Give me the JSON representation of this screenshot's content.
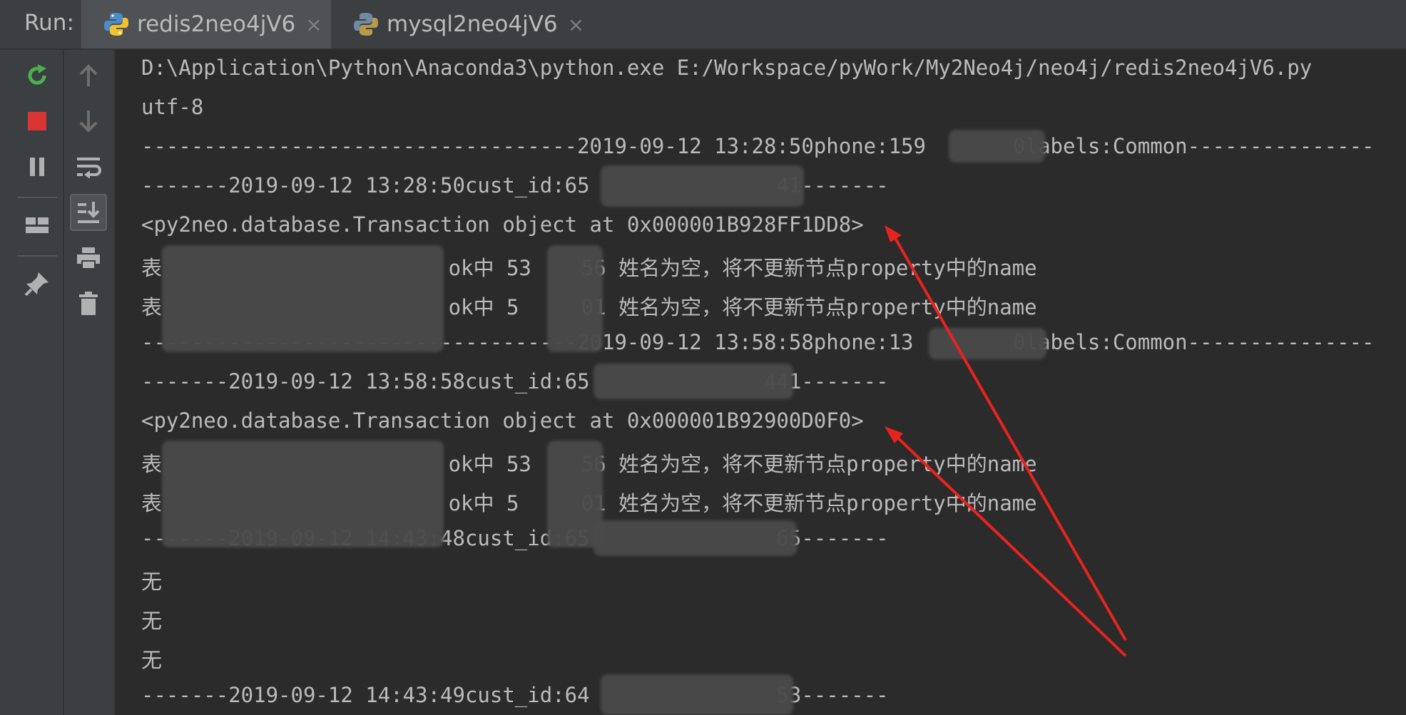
{
  "header": {
    "run_label": "Run:",
    "tabs": [
      {
        "label": "redis2neo4jV6",
        "close": "×"
      },
      {
        "label": "mysql2neo4jV6",
        "close": "×"
      }
    ]
  },
  "console": {
    "lines": [
      "D:\\Application\\Python\\Anaconda3\\python.exe E:/Workspace/pyWork/My2Neo4j/neo4j/redis2neo4jV6.py",
      "utf-8",
      "-----------------------------------2019-09-12 13:28:50phone:159       0labels:Common---------------",
      "-------2019-09-12 13:28:50cust_id:65               41-------",
      "<py2neo.database.Transaction object at 0x000001B928FF1DD8>",
      "表                       ok中 53    56 姓名为空，将不更新节点property中的name",
      "表                       ok中 5     01 姓名为空，将不更新节点property中的name",
      "-----------------------------------2019-09-12 13:58:58phone:13        0labels:Common---------------",
      "-------2019-09-12 13:58:58cust_id:65              441-------",
      "<py2neo.database.Transaction object at 0x000001B92900D0F0>",
      "表                       ok中 53    56 姓名为空，将不更新节点property中的name",
      "表                       ok中 5     01 姓名为空，将不更新节点property中的name",
      "-------2019-09-12 14:43:48cust_id:65               65-------",
      "无",
      "无",
      "无",
      "-------2019-09-12 14:43:49cust_id:64               53-------"
    ]
  },
  "icons": {
    "toolbar_left": [
      "rerun-icon",
      "stop-icon",
      "pause-icon",
      "layout-icon",
      "pin-icon"
    ],
    "toolbar_right": [
      "up-arrow-icon",
      "down-arrow-icon",
      "soft-wrap-icon",
      "scroll-to-end-icon",
      "print-icon",
      "trash-icon"
    ]
  },
  "colors": {
    "background": "#2b2b2b",
    "text": "#bbbbbb",
    "annotation_arrow": "#e8231f",
    "rerun": "#4caf50",
    "stop": "#db3434"
  }
}
